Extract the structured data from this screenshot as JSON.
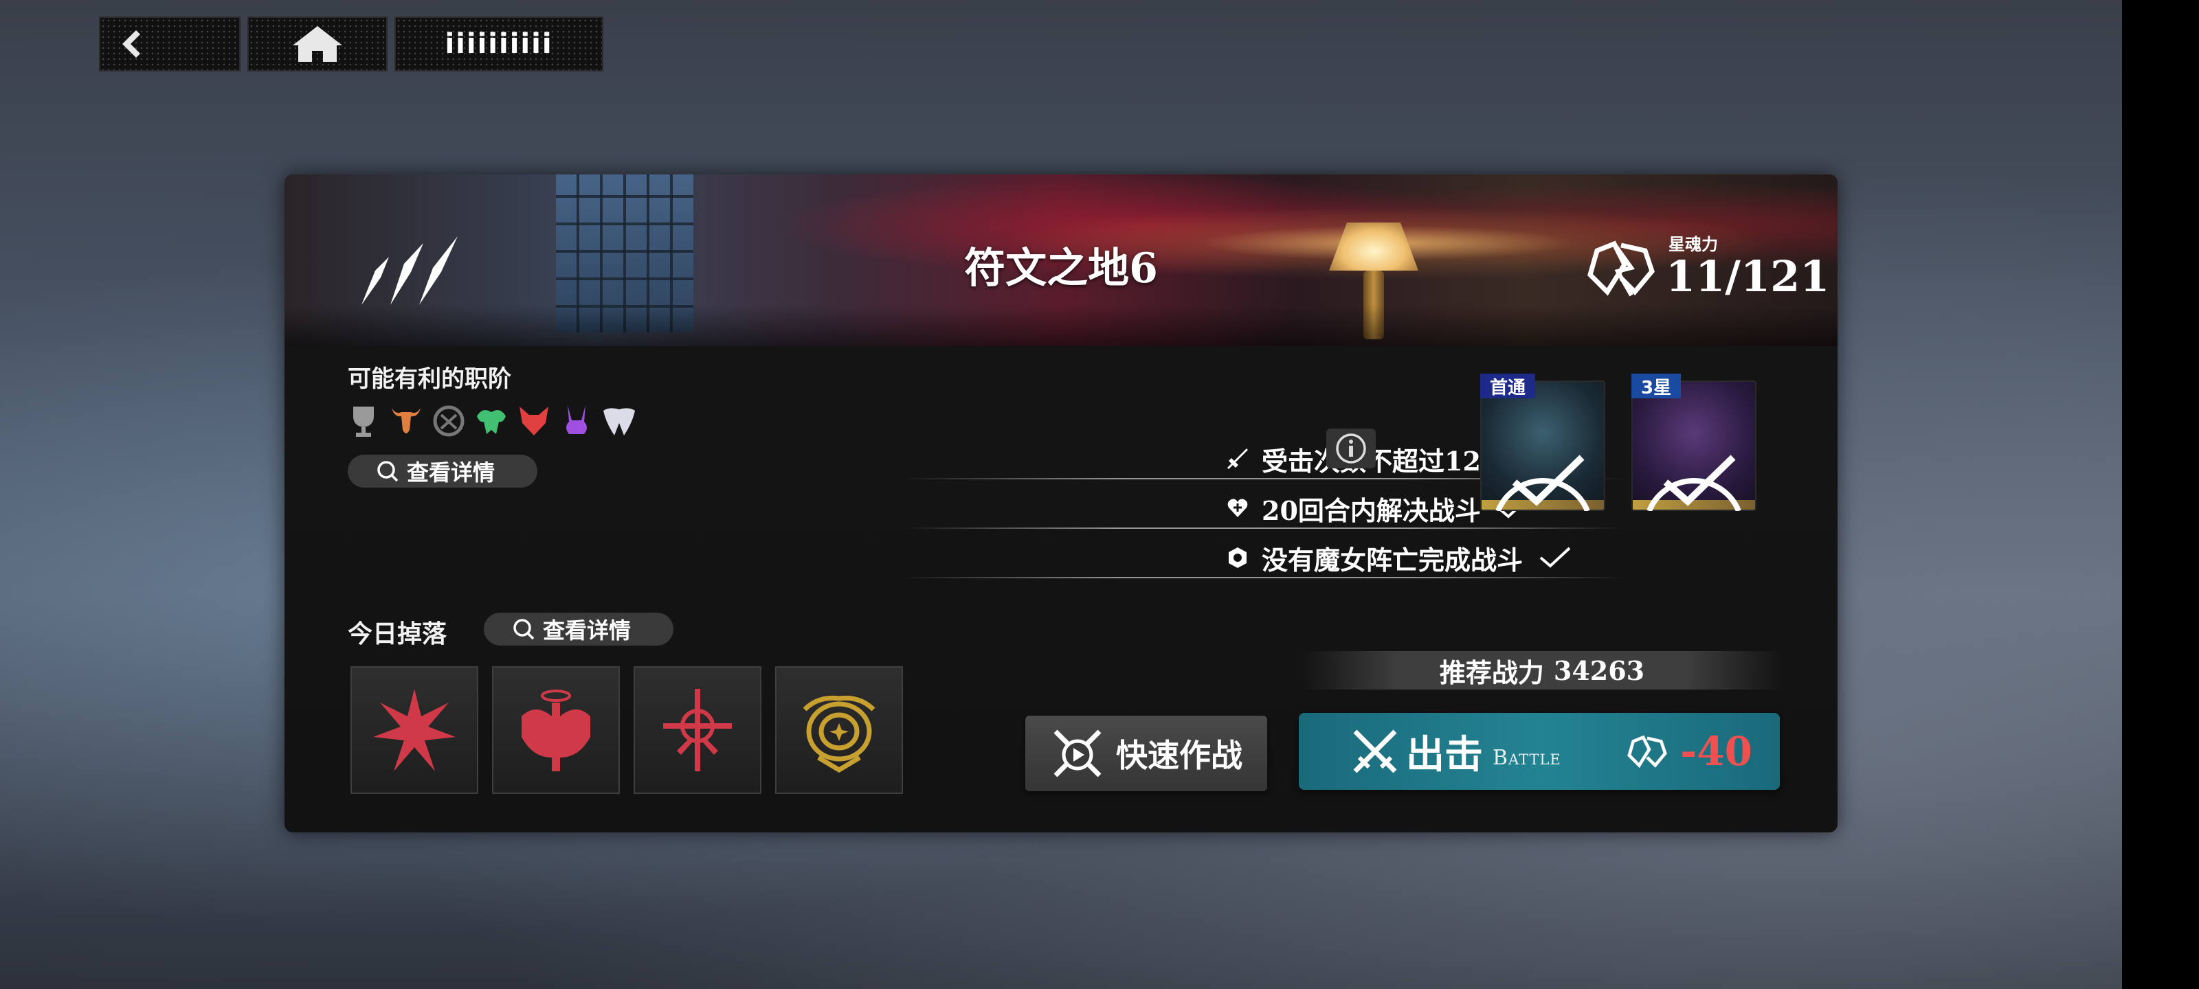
{
  "nav": {
    "back_icon": "back-arrow-icon",
    "home_icon": "home-icon",
    "extra_label": "iiiiiiiiii"
  },
  "stage": {
    "title": "符文之地6",
    "stars_icon": "three-stars-icon"
  },
  "energy": {
    "label": "星魂力",
    "value": "11/121"
  },
  "classes": {
    "title": "可能有利的职阶",
    "icons": [
      "trophy-class-icon",
      "bull-class-icon",
      "shield-class-icon",
      "dragon-class-icon",
      "wolf-class-icon",
      "rabbit-class-icon",
      "wings-class-icon"
    ],
    "colors": [
      "#a0a0a0",
      "#e08040",
      "#707070",
      "#40c070",
      "#e04040",
      "#a050e0",
      "#d8d8e8"
    ],
    "detail_label": "查看详情"
  },
  "objectives": [
    {
      "icon": "sword-icon",
      "text": "受击次数不超过12次"
    },
    {
      "icon": "heart-icon",
      "text": "20回合内解决战斗"
    },
    {
      "icon": "hexagon-icon",
      "text": "没有魔女阵亡完成战斗"
    }
  ],
  "rewards": [
    {
      "tag": "首通"
    },
    {
      "tag": "3星"
    }
  ],
  "drops": {
    "title": "今日掉落",
    "detail_label": "查看详情",
    "items": [
      "red-rune-emblem-1",
      "red-rune-emblem-2",
      "red-rune-emblem-3",
      "gold-rune-emblem"
    ]
  },
  "power": {
    "label": "推荐战力",
    "value": "34263"
  },
  "buttons": {
    "quick_label": "快速作战",
    "battle_zh": "出击",
    "battle_en": "Battle",
    "battle_cost": "-40"
  },
  "colors": {
    "battle_button": "#1f7a8a",
    "cost": "#f05050",
    "tag_first": "#1d2a8a",
    "tag_star": "#1a4aa0"
  }
}
